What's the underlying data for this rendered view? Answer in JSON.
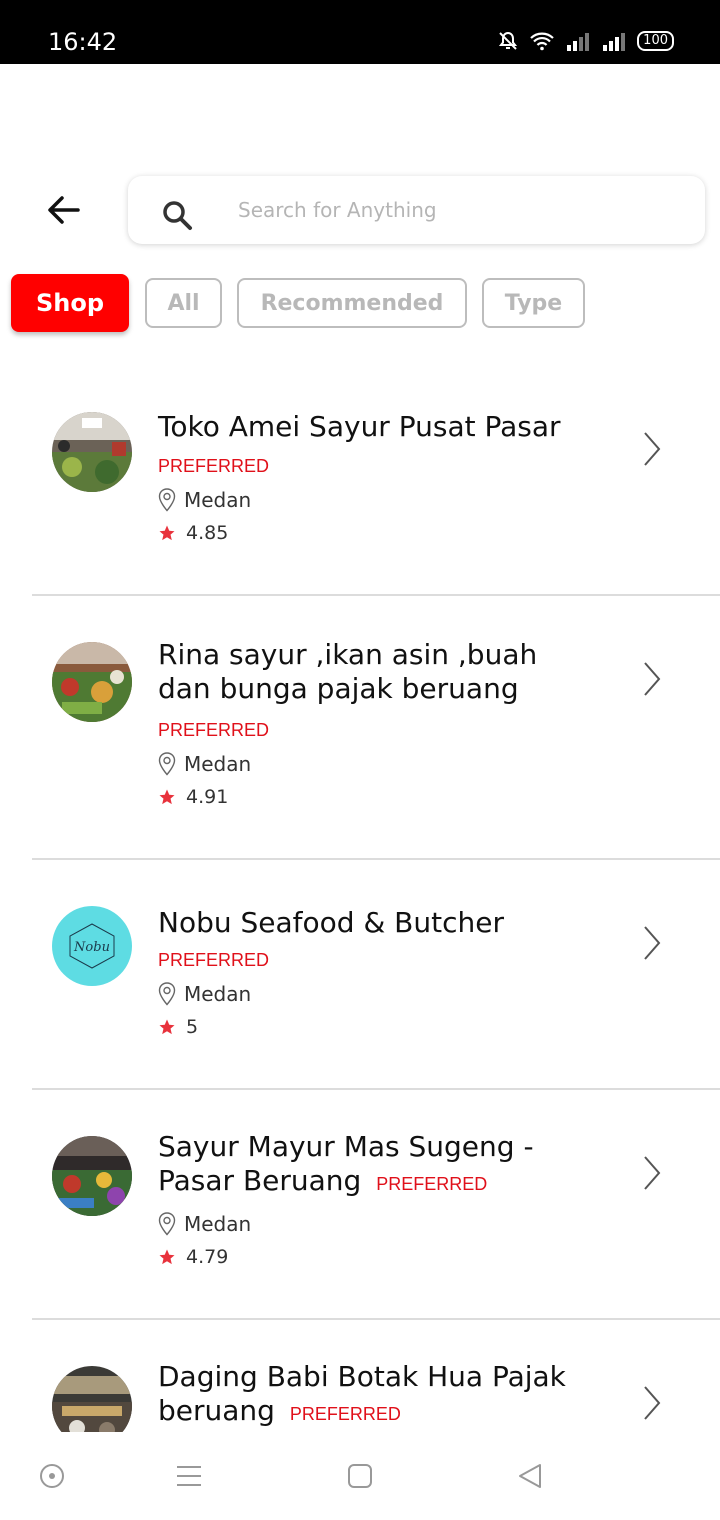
{
  "status_bar": {
    "time": "16:42",
    "battery": "100"
  },
  "search": {
    "placeholder": "Search for Anything"
  },
  "chips": [
    {
      "label": "Shop",
      "active": true
    },
    {
      "label": "All",
      "active": false
    },
    {
      "label": "Recommended",
      "active": false
    },
    {
      "label": "Type",
      "active": false
    }
  ],
  "shops": [
    {
      "name": "Toko Amei Sayur Pusat Pasar",
      "badge": "PREFERRED",
      "location": "Medan",
      "rating": "4.85"
    },
    {
      "name": "Rina sayur ,ikan asin ,buah dan bunga pajak beruang",
      "badge": "PREFERRED",
      "location": "Medan",
      "rating": "4.91"
    },
    {
      "name": "Nobu Seafood & Butcher",
      "badge": "PREFERRED",
      "location": "Medan",
      "rating": "5",
      "logo_text": "Nobu"
    },
    {
      "name_line1": "Sayur Mayur Mas Sugeng -",
      "name_line2": "Pasar Beruang",
      "badge": "PREFERRED",
      "location": "Medan",
      "rating": "4.79"
    },
    {
      "name_line1": "Daging Babi Botak Hua Pajak",
      "name_line2": "beruang",
      "badge": "PREFERRED"
    }
  ],
  "colors": {
    "accent": "#ff0000",
    "badge": "#e0101a",
    "star": "#e8323c"
  }
}
